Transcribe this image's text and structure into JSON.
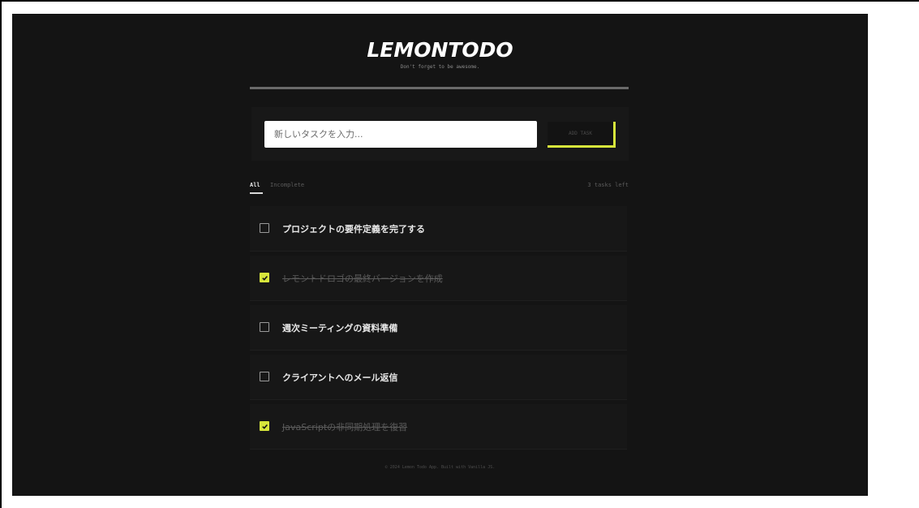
{
  "app": {
    "title": "LEMONTODO",
    "tagline": "Don't forget to be awesome."
  },
  "input": {
    "placeholder": "新しいタスクを入力...",
    "value": ""
  },
  "add_button": {
    "label": "ADD TASK"
  },
  "filters": {
    "all_label": "All",
    "incomplete_label": "Incomplete",
    "tasks_left": "3 tasks left"
  },
  "tasks": [
    {
      "text": "プロジェクトの要件定義を完了する",
      "done": false
    },
    {
      "text": "レモントドロゴの最終バージョンを作成",
      "done": true
    },
    {
      "text": "週次ミーティングの資料準備",
      "done": false
    },
    {
      "text": "クライアントへのメール返信",
      "done": false
    },
    {
      "text": "JavaScriptの非同期処理を復習",
      "done": true
    }
  ],
  "footer": {
    "text": "© 2024 Lemon Todo App. Built with Vanilla JS."
  },
  "colors": {
    "accent": "#d7e63b",
    "background": "#141414"
  }
}
